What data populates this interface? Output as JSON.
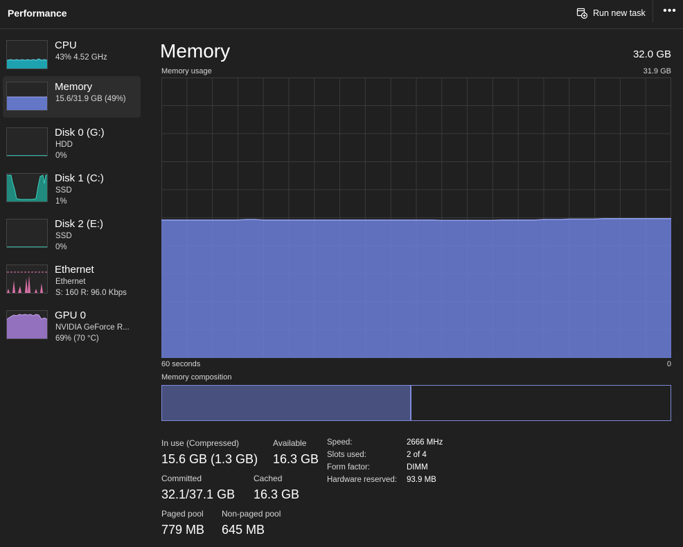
{
  "header": {
    "title": "Performance",
    "run_new_task": "Run new task",
    "more": "•••"
  },
  "sidebar": {
    "items": [
      {
        "name": "CPU",
        "line2": "43% 4.52 GHz",
        "line3": "",
        "color": "#1fb8c9"
      },
      {
        "name": "Memory",
        "line2": "15.6/31.9 GB (49%)",
        "line3": "",
        "color": "#6c7fd8",
        "selected": true
      },
      {
        "name": "Disk 0 (G:)",
        "line2": "HDD",
        "line3": "0%",
        "color": "#2fb5a3"
      },
      {
        "name": "Disk 1 (C:)",
        "line2": "SSD",
        "line3": "1%",
        "color": "#2fb5a3"
      },
      {
        "name": "Disk 2 (E:)",
        "line2": "SSD",
        "line3": "0%",
        "color": "#2fb5a3"
      },
      {
        "name": "Ethernet",
        "line2": "Ethernet",
        "line3": "S: 160  R: 96.0 Kbps",
        "color": "#f07ab8"
      },
      {
        "name": "GPU 0",
        "line2": "NVIDIA GeForce R...",
        "line3": "69% (70 °C)",
        "color": "#a07ad0"
      }
    ]
  },
  "main": {
    "title": "Memory",
    "total": "32.0 GB",
    "usage_label": "Memory usage",
    "usage_max": "31.9 GB",
    "time_left": "60 seconds",
    "time_right": "0",
    "composition_label": "Memory composition"
  },
  "chart_data": {
    "type": "area",
    "title": "Memory usage",
    "xlabel": "",
    "ylabel": "",
    "x_range_seconds": [
      60,
      0
    ],
    "ylim": [
      0,
      31.9
    ],
    "grid": true,
    "values_gb": [
      15.7,
      15.7,
      15.7,
      15.7,
      15.7,
      15.7,
      15.7,
      15.7,
      15.7,
      15.7,
      15.75,
      15.75,
      15.7,
      15.7,
      15.7,
      15.7,
      15.7,
      15.7,
      15.7,
      15.7,
      15.7,
      15.7,
      15.7,
      15.7,
      15.7,
      15.7,
      15.7,
      15.7,
      15.7,
      15.7,
      15.7,
      15.7,
      15.7,
      15.65,
      15.65,
      15.65,
      15.65,
      15.65,
      15.65,
      15.65,
      15.7,
      15.7,
      15.7,
      15.7,
      15.7,
      15.75,
      15.75,
      15.75,
      15.8,
      15.8,
      15.8,
      15.8,
      15.85,
      15.85,
      15.85,
      15.85,
      15.85,
      15.85,
      15.85,
      15.85,
      15.85
    ],
    "color": "#6c7fd8"
  },
  "composition": {
    "in_use_fraction": 0.49
  },
  "stats": {
    "in_use_label": "In use (Compressed)",
    "in_use_value": "15.6 GB (1.3 GB)",
    "available_label": "Available",
    "available_value": "16.3 GB",
    "committed_label": "Committed",
    "committed_value": "32.1/37.1 GB",
    "cached_label": "Cached",
    "cached_value": "16.3 GB",
    "paged_label": "Paged pool",
    "paged_value": "779 MB",
    "nonpaged_label": "Non-paged pool",
    "nonpaged_value": "645 MB"
  },
  "specs": {
    "speed_label": "Speed:",
    "speed_value": "2666 MHz",
    "slots_label": "Slots used:",
    "slots_value": "2 of 4",
    "form_label": "Form factor:",
    "form_value": "DIMM",
    "reserved_label": "Hardware reserved:",
    "reserved_value": "93.9 MB"
  }
}
